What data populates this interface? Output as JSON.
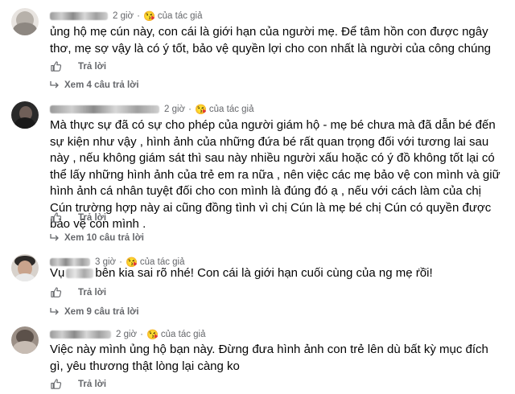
{
  "comments": [
    {
      "time": "2 giờ",
      "badge": "của tác giả",
      "text": "ủng hộ mẹ cún này, con cái là giới hạn của người mẹ. Để tâm hồn con được ngây thơ, mẹ sợ vậy là có ý tốt, bảo vệ quyền lợi cho con nhất là người của công chúng",
      "reply_label": "Trả lời",
      "view_replies": "Xem 4 câu trả lời"
    },
    {
      "time": "2 giờ",
      "badge": "của tác giả",
      "text": "Mà thực sự đã có sự cho phép của người giám hộ - mẹ bé chưa mà đã dẫn bé đến sự kiện như vậy , hình ảnh của những đứa bé rất quan trọng đối với tương lai sau này , nếu không giám sát thì sau này nhiều người xấu hoặc có ý đồ không tốt lại có thể lấy những hình ảnh của trẻ em ra nữa , nên việc các mẹ bảo vệ con mình và giữ hình ảnh cá nhân tuyệt đối cho con mình là đúng đó ạ , nếu với cách làm của chị Cún trường hợp này ai cũng đồng tình vì chị Cún là mẹ bé chị Cún có quyền được bảo vệ con mình .",
      "reply_label": "Trả lời",
      "view_replies": "Xem 10 câu trả lời"
    },
    {
      "time": "3 giờ",
      "badge": "của tác giả",
      "text_before": "Vụ",
      "text_after": "bên kia sai rõ nhé! Con cái là giới hạn cuối cùng của ng mẹ rồi!",
      "reply_label": "Trả lời",
      "view_replies": "Xem 9 câu trả lời",
      "more": "···"
    },
    {
      "time": "2 giờ",
      "badge": "của tác giả",
      "text": "Việc này mình ủng hộ bạn này. Đừng đưa hình ảnh con trẻ lên dù bất kỳ mục đích gì, yêu thương thật lòng lại càng ko",
      "reply_label": "Trả lời"
    }
  ],
  "colors": {
    "text": "#050505",
    "meta": "#65676b",
    "link": "#65676b"
  },
  "icons": {
    "like": "thumbs-up-icon",
    "reply": "reply-arrow-icon",
    "badge": "author-badge-emoji"
  },
  "badge_emoji": "😘",
  "sep": "·"
}
